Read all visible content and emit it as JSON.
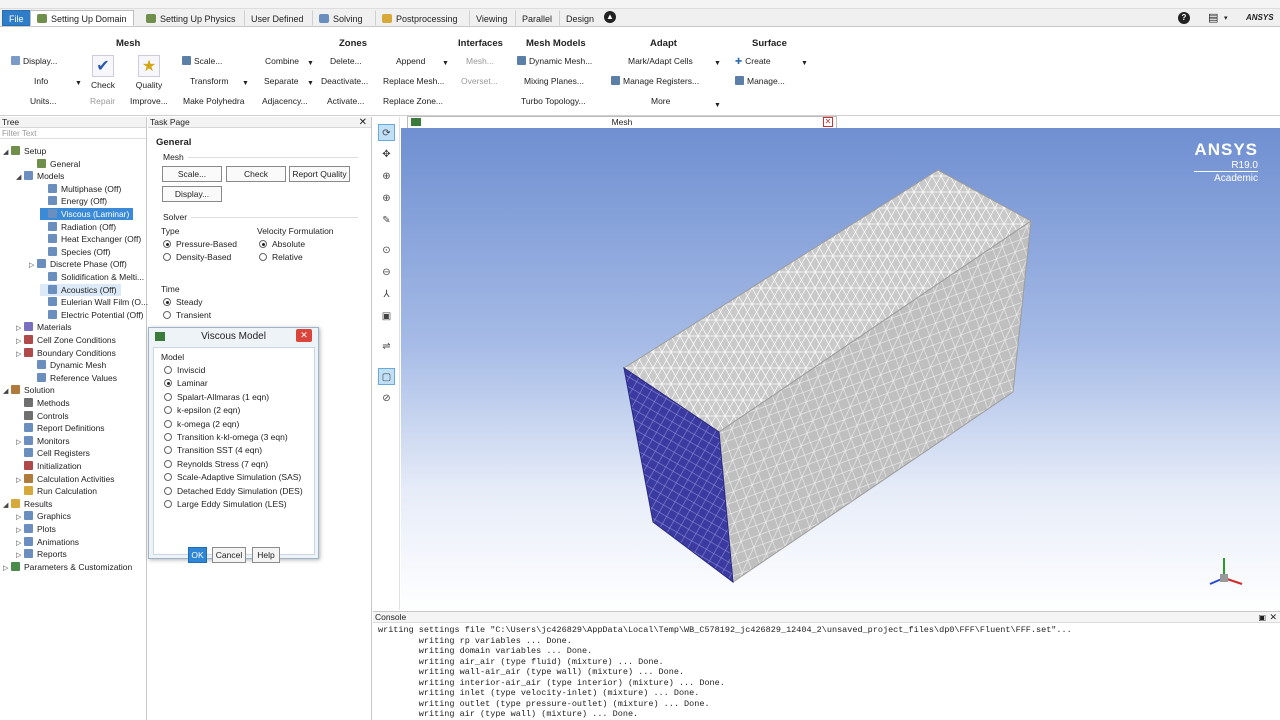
{
  "menubar": {
    "tabs": [
      {
        "label": "File"
      },
      {
        "label": "Setting Up Domain"
      },
      {
        "label": "Setting Up Physics"
      },
      {
        "label": "User Defined"
      },
      {
        "label": "Solving"
      },
      {
        "label": "Postprocessing"
      },
      {
        "label": "Viewing"
      },
      {
        "label": "Parallel"
      },
      {
        "label": "Design"
      }
    ],
    "brand": "ANSYS"
  },
  "ribbon": {
    "mesh": {
      "title": "Mesh",
      "display": "Display...",
      "info": "Info",
      "units": "Units...",
      "check": "Check",
      "quality": "Quality",
      "repair": "Repair",
      "improve": "Improve...",
      "scale": "Scale...",
      "transform": "Transform",
      "make_polyhedra": "Make Polyhedra"
    },
    "zones": {
      "title": "Zones",
      "combine": "Combine",
      "separate": "Separate",
      "adjacency": "Adjacency...",
      "delete": "Delete...",
      "deactivate": "Deactivate...",
      "activate": "Activate...",
      "append": "Append",
      "replace_mesh": "Replace Mesh...",
      "replace_zone": "Replace Zone..."
    },
    "interfaces": {
      "title": "Interfaces",
      "mesh": "Mesh...",
      "overset": "Overset..."
    },
    "mesh_models": {
      "title": "Mesh Models",
      "dynamic_mesh": "Dynamic Mesh...",
      "mixing_planes": "Mixing Planes...",
      "turbo_topology": "Turbo Topology..."
    },
    "adapt": {
      "title": "Adapt",
      "mark_adapt": "Mark/Adapt Cells",
      "manage_registers": "Manage Registers...",
      "more": "More"
    },
    "surface": {
      "title": "Surface",
      "create": "Create",
      "manage": "Manage..."
    }
  },
  "tree": {
    "header": "Tree",
    "filter_placeholder": "Filter Text",
    "nodes": [
      {
        "label": "Setup"
      },
      {
        "label": "General"
      },
      {
        "label": "Models"
      },
      {
        "label": "Multiphase (Off)"
      },
      {
        "label": "Energy (Off)"
      },
      {
        "label": "Viscous (Laminar)"
      },
      {
        "label": "Radiation (Off)"
      },
      {
        "label": "Heat Exchanger (Off)"
      },
      {
        "label": "Species (Off)"
      },
      {
        "label": "Discrete Phase (Off)"
      },
      {
        "label": "Solidification & Melti..."
      },
      {
        "label": "Acoustics (Off)"
      },
      {
        "label": "Eulerian Wall Film (O..."
      },
      {
        "label": "Electric Potential (Off)"
      },
      {
        "label": "Materials"
      },
      {
        "label": "Cell Zone Conditions"
      },
      {
        "label": "Boundary Conditions"
      },
      {
        "label": "Dynamic Mesh"
      },
      {
        "label": "Reference Values"
      },
      {
        "label": "Solution"
      },
      {
        "label": "Methods"
      },
      {
        "label": "Controls"
      },
      {
        "label": "Report Definitions"
      },
      {
        "label": "Monitors"
      },
      {
        "label": "Cell Registers"
      },
      {
        "label": "Initialization"
      },
      {
        "label": "Calculation Activities"
      },
      {
        "label": "Run Calculation"
      },
      {
        "label": "Results"
      },
      {
        "label": "Graphics"
      },
      {
        "label": "Plots"
      },
      {
        "label": "Animations"
      },
      {
        "label": "Reports"
      },
      {
        "label": "Parameters & Customization"
      }
    ]
  },
  "task_page": {
    "header": "Task Page",
    "title": "General",
    "mesh_group": "Mesh",
    "scale_btn": "Scale...",
    "check_btn": "Check",
    "report_quality_btn": "Report Quality",
    "display_btn": "Display...",
    "solver_group": "Solver",
    "type_label": "Type",
    "pressure_based": "Pressure-Based",
    "density_based": "Density-Based",
    "velocity_label": "Velocity Formulation",
    "absolute": "Absolute",
    "relative": "Relative",
    "time_label": "Time",
    "steady": "Steady",
    "transient": "Transient"
  },
  "dialog": {
    "title": "Viscous Model",
    "model_group": "Model",
    "models": [
      {
        "label": "Inviscid",
        "selected": false
      },
      {
        "label": "Laminar",
        "selected": true
      },
      {
        "label": "Spalart-Allmaras (1 eqn)",
        "selected": false
      },
      {
        "label": "k-epsilon (2 eqn)",
        "selected": false
      },
      {
        "label": "k-omega (2 eqn)",
        "selected": false
      },
      {
        "label": "Transition k-kl-omega (3 eqn)",
        "selected": false
      },
      {
        "label": "Transition SST (4 eqn)",
        "selected": false
      },
      {
        "label": "Reynolds Stress (7 eqn)",
        "selected": false
      },
      {
        "label": "Scale-Adaptive Simulation (SAS)",
        "selected": false
      },
      {
        "label": "Detached Eddy Simulation (DES)",
        "selected": false
      },
      {
        "label": "Large Eddy Simulation (LES)",
        "selected": false
      }
    ],
    "ok": "OK",
    "cancel": "Cancel",
    "help": "Help"
  },
  "viewport": {
    "tab_label": "Mesh",
    "logo_brand": "ANSYS",
    "logo_version": "R19.0",
    "logo_edition": "Academic",
    "face_color": "#3a3aa0",
    "mesh_color": "#c9c9c9"
  },
  "console": {
    "header": "Console",
    "lines": [
      "writing settings file \"C:\\Users\\jc426829\\AppData\\Local\\Temp\\WB_C578192_jc426829_12404_2\\unsaved_project_files\\dp0\\FFF\\Fluent\\FFF.set\"...",
      "        writing rp variables ... Done.",
      "        writing domain variables ... Done.",
      "        writing air_air (type fluid) (mixture) ... Done.",
      "        writing wall-air_air (type wall) (mixture) ... Done.",
      "        writing interior-air_air (type interior) (mixture) ... Done.",
      "        writing inlet (type velocity-inlet) (mixture) ... Done.",
      "        writing outlet (type pressure-outlet) (mixture) ... Done.",
      "        writing air (type wall) (mixture) ... Done."
    ]
  }
}
